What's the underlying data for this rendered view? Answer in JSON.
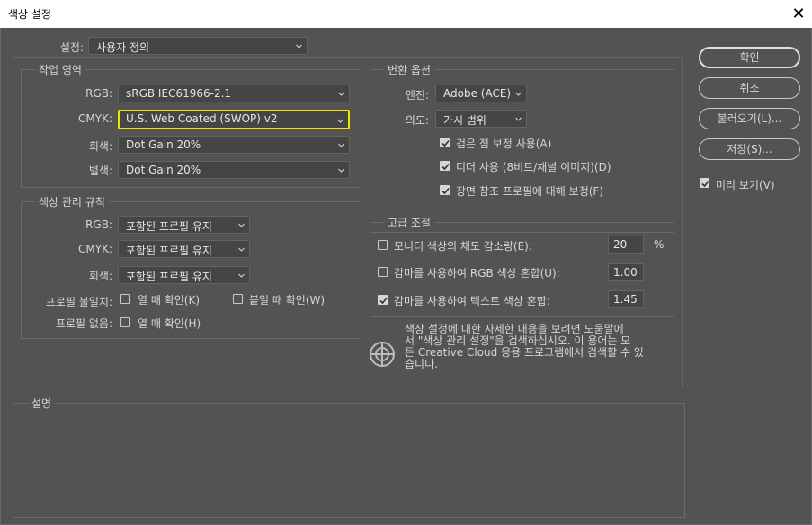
{
  "window": {
    "title": "색상 설정",
    "close_glyph": "✕"
  },
  "settings": {
    "label": "설정:",
    "value": "사용자 정의"
  },
  "workspace": {
    "title": "작업 영역",
    "rgb": {
      "label": "RGB:",
      "value": "sRGB IEC61966-2.1"
    },
    "cmyk": {
      "label": "CMYK:",
      "value": "U.S. Web Coated (SWOP) v2"
    },
    "gray": {
      "label": "회색:",
      "value": "Dot Gain 20%"
    },
    "spot": {
      "label": "별색:",
      "value": "Dot Gain 20%"
    }
  },
  "policies": {
    "title": "색상 관리 규칙",
    "rgb": {
      "label": "RGB:",
      "value": "포함된 프로필 유지"
    },
    "cmyk": {
      "label": "CMYK:",
      "value": "포함된 프로필 유지"
    },
    "gray": {
      "label": "회색:",
      "value": "포함된 프로필 유지"
    },
    "mismatch_label": "프로필 불일치:",
    "ask_open": {
      "label": "열 때 확인(K)",
      "checked": false
    },
    "ask_paste": {
      "label": "붙일 때 확인(W)",
      "checked": false
    },
    "missing_label": "프로필 없음:",
    "ask_missing": {
      "label": "열 때 확인(H)",
      "checked": false
    }
  },
  "conversion": {
    "title": "변환 옵션",
    "engine": {
      "label": "엔진:",
      "value": "Adobe (ACE)"
    },
    "intent": {
      "label": "의도:",
      "value": "가시 범위"
    },
    "bpc": {
      "label": "검은 점 보정 사용(A)",
      "checked": true
    },
    "dither": {
      "label": "디더 사용 (8비트/채널 이미지)(D)",
      "checked": true
    },
    "scene": {
      "label": "장면 참조 프로필에 대해 보정(F)",
      "checked": true
    }
  },
  "advanced": {
    "title": "고급 조절",
    "desat": {
      "label": "모니터 색상의 채도 감소량(E):",
      "value": "20",
      "unit": "%",
      "checked": false
    },
    "gamma_rgb": {
      "label": "감마를 사용하여 RGB 색상 혼합(U):",
      "value": "1.00",
      "checked": false
    },
    "gamma_text": {
      "label": "감마를 사용하여 텍스트 색상 혼합:",
      "value": "1.45",
      "checked": true
    }
  },
  "info": {
    "icon": "color-wheel-icon",
    "line1": "색상 설정에 대한 자세한 내용을 보려면 도움말에",
    "line2": "서 \"색상 관리 설정\"을 검색하십시오. 이 용어는 모",
    "line3": "든 Creative Cloud 응용 프로그램에서 검색할 수 있",
    "line4": "습니다."
  },
  "description": {
    "title": "설명"
  },
  "buttons": {
    "ok": "확인",
    "cancel": "취소",
    "load": "불러오기(L)...",
    "save": "저장(S)..."
  },
  "preview": {
    "label": "미리 보기(V)",
    "checked": true
  },
  "colors": {
    "background": "#535353",
    "highlight": "#f2e400",
    "border": "#6a6a6a"
  }
}
